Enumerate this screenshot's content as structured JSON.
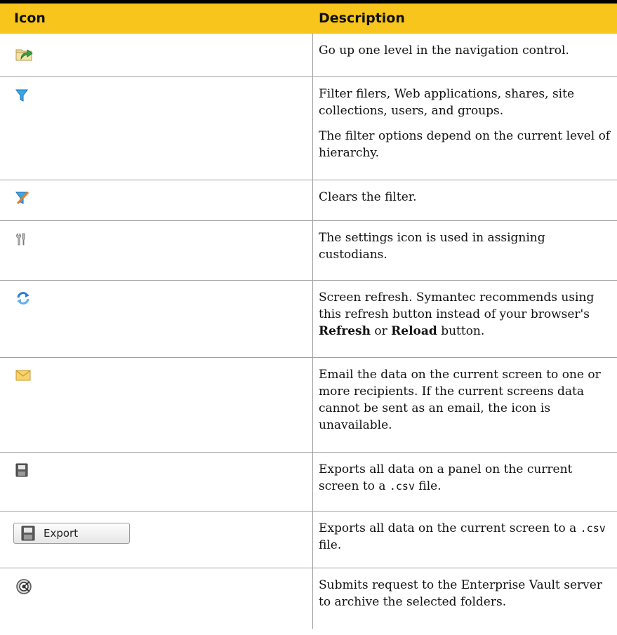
{
  "header": {
    "icon": "Icon",
    "description": "Description"
  },
  "rows": [
    {
      "icon": "folder-up-icon",
      "paras": [
        "Go up one level in the navigation control."
      ]
    },
    {
      "icon": "filter-icon",
      "paras": [
        "Filter filers, Web applications, shares, site collections, users, and groups.",
        "The filter options depend on the current level of hierarchy."
      ]
    },
    {
      "icon": "clear-filter-icon",
      "paras": [
        "Clears the filter."
      ]
    },
    {
      "icon": "settings-icon",
      "paras": [
        "The settings icon is used in assigning custodians."
      ]
    },
    {
      "icon": "refresh-icon",
      "p1": "Screen refresh. Symantec recommends using this refresh button instead of your browser's ",
      "b1": "Refresh",
      "mid": " or ",
      "b2": "Reload",
      "end": " button."
    },
    {
      "icon": "email-icon",
      "paras": [
        "Email the data on the current screen to one or more recipients. If the current screens data cannot be sent as an email, the icon is unavailable."
      ]
    },
    {
      "icon": "save-icon",
      "pre": "Exports all data on a panel on the current screen to a ",
      "code": ".csv",
      "post": " file."
    },
    {
      "icon": "export-button",
      "label": "Export",
      "pre": "Exports all data on the current screen to a ",
      "code": ".csv",
      "post": " file."
    },
    {
      "icon": "archive-icon",
      "paras": [
        "Submits request to the Enterprise Vault server to archive the selected folders."
      ]
    }
  ]
}
